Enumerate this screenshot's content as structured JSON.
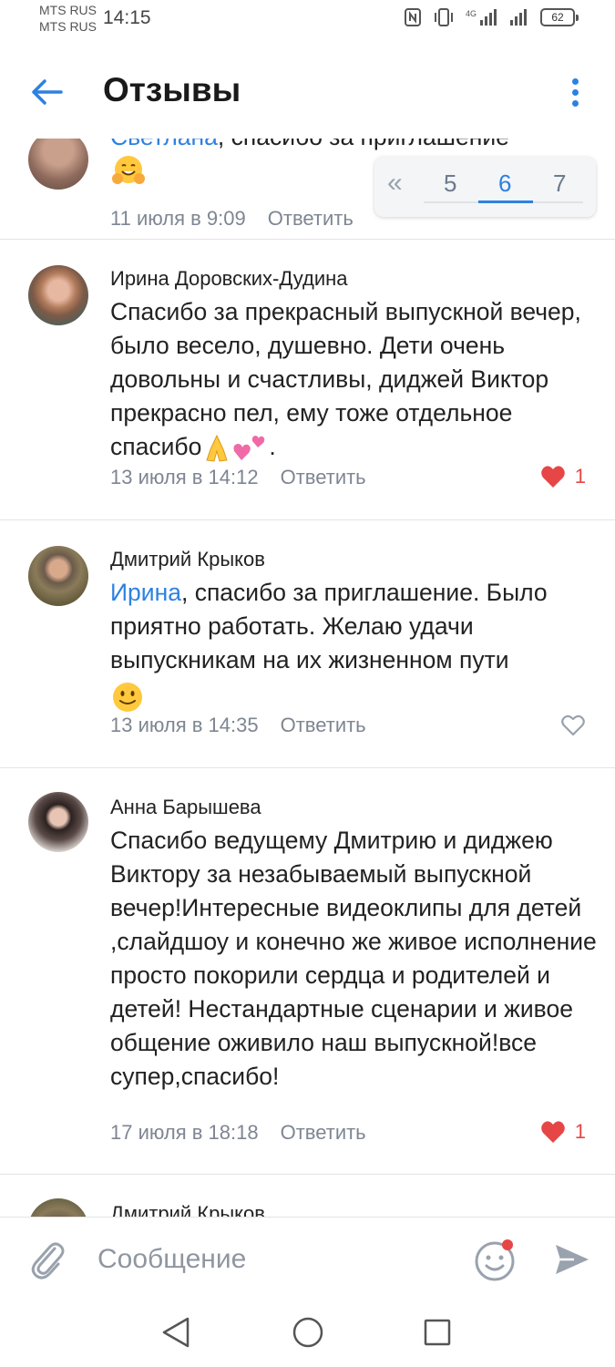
{
  "status_bar": {
    "carrier_1": "MTS RUS",
    "carrier_2": "MTS RUS",
    "time": "14:15",
    "battery": "62"
  },
  "header": {
    "title": "Отзывы"
  },
  "pager": {
    "prev_symbol": "«",
    "pages": [
      "5",
      "6",
      "7"
    ],
    "current": "6"
  },
  "comments": [
    {
      "author": "Светлана",
      "mention": "Светлана",
      "text": ", спасибо за приглашение",
      "emoji": "hugging-face",
      "date": "11 июля в 9:09",
      "reply": "Ответить"
    },
    {
      "author": "Ирина Доровских-Дудина",
      "text": "Спасибо за прекрасный выпускной вечер, было весело, душевно. Дети очень довольны и счастливы, диджей Виктор прекрасно пел, ему тоже отдельное спасибо",
      "text_end": ".",
      "emojis": [
        "folded-hands",
        "two-hearts"
      ],
      "date": "13 июля в 14:12",
      "reply": "Ответить",
      "likes": "1",
      "liked": true
    },
    {
      "author": "Дмитрий Крыков",
      "mention": "Ирина",
      "text": ", спасибо за приглашение. Было приятно работать. Желаю удачи выпускникам на их жизненном пути",
      "emoji": "slightly-smiling-face",
      "date": "13 июля в 14:35",
      "reply": "Ответить",
      "liked": false
    },
    {
      "author": "Анна Барышева",
      "text": "Спасибо ведущему Дмитрию и диджею Виктору за незабываемый выпускной вечер!Интересные видеоклипы для детей ,слайдшоу и конечно же живое исполнение просто покорили сердца и родителей и детей! Нестандартные сценарии и живое общение оживило наш выпускной!все супер,спасибо!",
      "date": "17 июля в 18:18",
      "reply": "Ответить",
      "likes": "1",
      "liked": true
    },
    {
      "author": "Дмитрий Крыков"
    }
  ],
  "composer": {
    "placeholder": "Сообщение"
  },
  "colors": {
    "accent": "#2d81e0",
    "like": "#e64646",
    "meta": "#7e8692"
  }
}
